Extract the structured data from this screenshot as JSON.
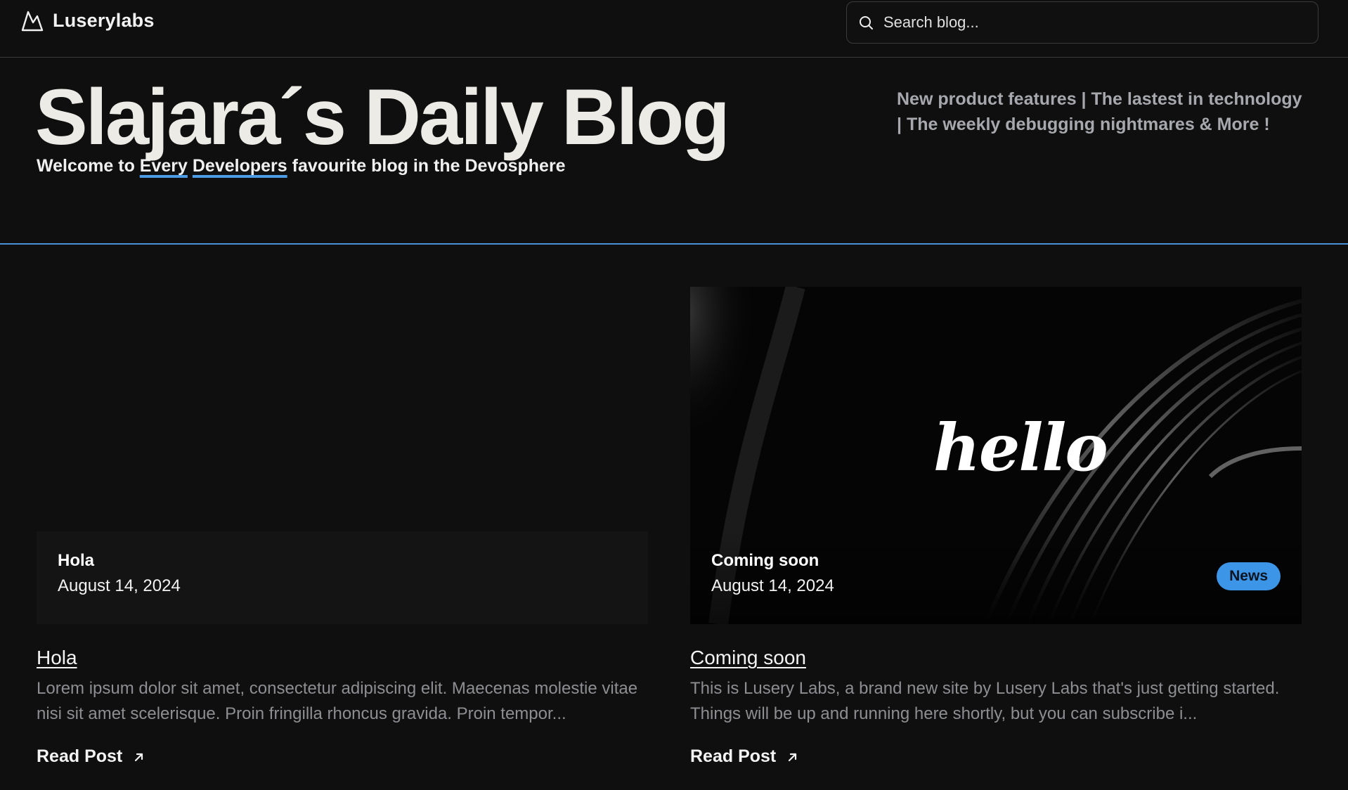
{
  "nav": {
    "brand": "Luserylabs",
    "brand_icon": "mountain-logo-icon",
    "search_placeholder": "Search blog...",
    "search_value": ""
  },
  "hero": {
    "title": "Slajara´s Daily Blog",
    "subtitle_prefix": "Welcome to ",
    "subtitle_highlight_1": "Every",
    "subtitle_space": " ",
    "subtitle_highlight_2": "Developers",
    "subtitle_suffix": " favourite blog in the Devosphere",
    "tagline": "New product features | The lastest in technology | The weekly debugging nightmares & More !"
  },
  "colors": {
    "background": "#0f0f0f",
    "accent": "#3d95e8",
    "divider": "#4a90d9",
    "muted_text": "#8d8e92"
  },
  "posts": [
    {
      "overlay_title": "Hola",
      "date": "August 14, 2024",
      "title": "Hola",
      "excerpt": "Lorem ipsum dolor sit amet, consectetur adipiscing elit. Maecenas molestie vitae nisi sit amet scelerisque. Proin fringilla rhoncus gravida. Proin tempor...",
      "read_label": "Read Post",
      "tag": ""
    },
    {
      "overlay_title": "Coming soon",
      "date": "August 14, 2024",
      "title": "Coming soon",
      "excerpt": "This is Lusery Labs, a brand new site by Lusery Labs that's just getting started. Things will be up and running here shortly, but you can subscribe i...",
      "read_label": "Read Post",
      "tag": "News",
      "image_text": "hello"
    }
  ]
}
